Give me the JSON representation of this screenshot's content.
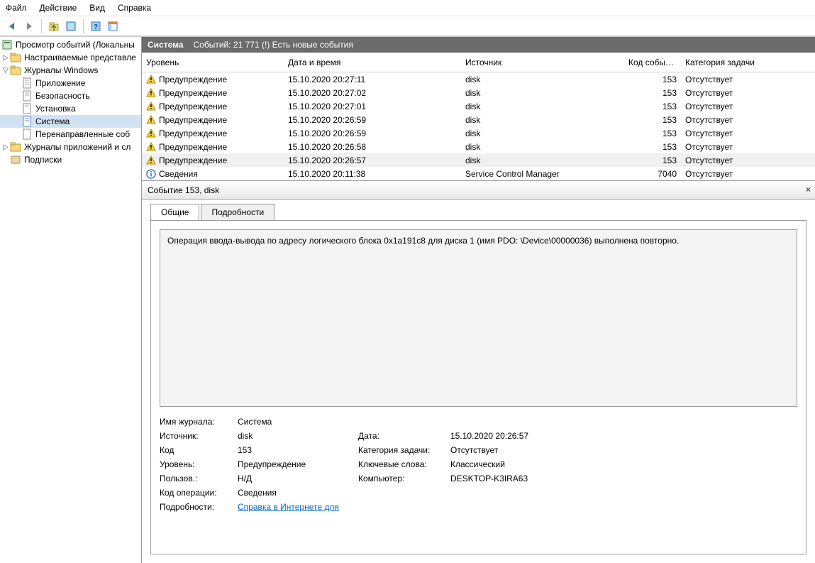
{
  "menu": {
    "items": [
      "Файл",
      "Действие",
      "Вид",
      "Справка"
    ]
  },
  "tree": {
    "root": "Просмотр событий (Локальны",
    "custom_views": "Настраиваемые представле",
    "win_logs": "Журналы Windows",
    "app": "Приложение",
    "sec": "Безопасность",
    "setup": "Установка",
    "system": "Система",
    "fwd": "Перенаправленные соб",
    "app_svc": "Журналы приложений и сл",
    "subs": "Подписки"
  },
  "header": {
    "title": "Система",
    "count": "Событий: 21 771 (!) Есть новые события"
  },
  "columns": {
    "level": "Уровень",
    "date": "Дата и время",
    "src": "Источник",
    "id": "Код события",
    "cat": "Категория задачи"
  },
  "levels": {
    "warning": "Предупреждение",
    "info": "Сведения"
  },
  "rows": [
    {
      "level": "warning",
      "date": "15.10.2020 20:27:11",
      "src": "disk",
      "id": "153",
      "cat": "Отсутствует"
    },
    {
      "level": "warning",
      "date": "15.10.2020 20:27:02",
      "src": "disk",
      "id": "153",
      "cat": "Отсутствует"
    },
    {
      "level": "warning",
      "date": "15.10.2020 20:27:01",
      "src": "disk",
      "id": "153",
      "cat": "Отсутствует"
    },
    {
      "level": "warning",
      "date": "15.10.2020 20:26:59",
      "src": "disk",
      "id": "153",
      "cat": "Отсутствует"
    },
    {
      "level": "warning",
      "date": "15.10.2020 20:26:59",
      "src": "disk",
      "id": "153",
      "cat": "Отсутствует"
    },
    {
      "level": "warning",
      "date": "15.10.2020 20:26:58",
      "src": "disk",
      "id": "153",
      "cat": "Отсутствует"
    },
    {
      "level": "warning",
      "date": "15.10.2020 20:26:57",
      "src": "disk",
      "id": "153",
      "cat": "Отсутствует",
      "selected": true
    },
    {
      "level": "info",
      "date": "15.10.2020 20:11:38",
      "src": "Service Control Manager",
      "id": "7040",
      "cat": "Отсутствует"
    }
  ],
  "detail": {
    "header": "Событие 153, disk",
    "tabs": {
      "general": "Общие",
      "details": "Подробности"
    },
    "description": "Операция ввода-вывода по адресу логического блока 0x1a191c8 для диска 1 (имя PDO: \\Device\\00000036) выполнена повторно.",
    "labels": {
      "log": "Имя журнала:",
      "src": "Источник:",
      "code": "Код",
      "level": "Уровень:",
      "user": "Пользов.:",
      "op": "Код операции:",
      "more": "Подробности:",
      "date": "Дата:",
      "cat": "Категория задачи:",
      "keywords": "Ключевые слова:",
      "computer": "Компьютер:"
    },
    "values": {
      "log": "Система",
      "src": "disk",
      "code": "153",
      "level": "Предупреждение",
      "user": "Н/Д",
      "op": "Сведения",
      "date": "15.10.2020 20:26:57",
      "cat": "Отсутствует",
      "keywords": "Классический",
      "computer": "DESKTOP-K3IRA63",
      "more_link": "Справка в Интернете для"
    }
  }
}
